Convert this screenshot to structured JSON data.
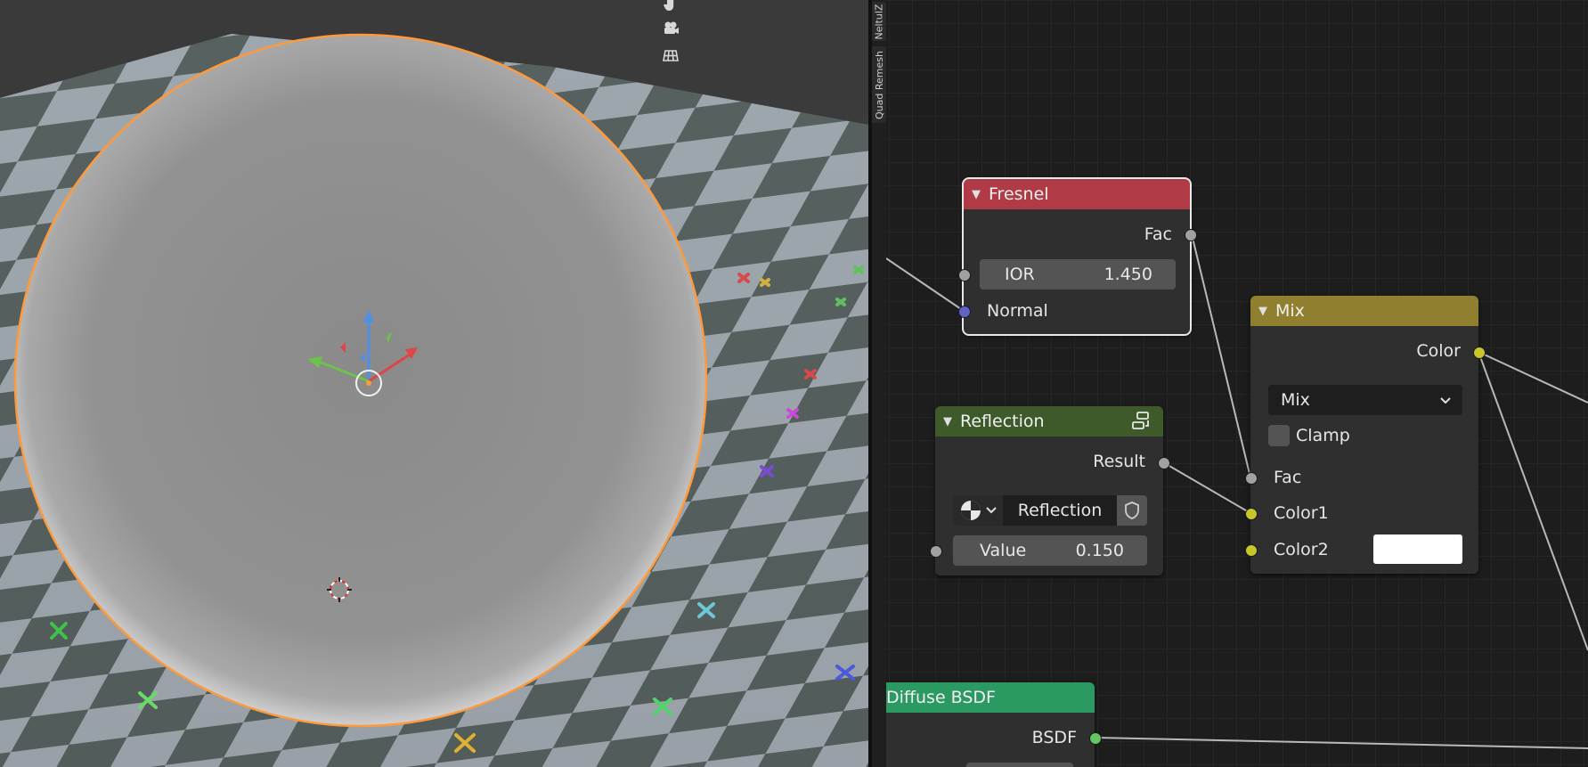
{
  "viewport": {
    "header_icons": [
      "hand-icon",
      "camera-icon",
      "grid-icon"
    ]
  },
  "sidebar_tabs": [
    "NeltulZ",
    "Quad Remesh"
  ],
  "nodes": {
    "fresnel": {
      "title": "Fresnel",
      "header_color": "#b03a45",
      "output_fac": "Fac",
      "ior_label": "IOR",
      "ior_value": "1.450",
      "normal_label": "Normal"
    },
    "mix": {
      "title": "Mix",
      "header_color": "#8f7f2e",
      "output_color": "Color",
      "blend_mode": "Mix",
      "clamp_label": "Clamp",
      "fac_label": "Fac",
      "color1_label": "Color1",
      "color2_label": "Color2",
      "color2_value": "#ffffff"
    },
    "reflection": {
      "title": "Reflection",
      "header_color": "#3f5a2a",
      "output_result": "Result",
      "texture_name": "Reflection",
      "value_label": "Value",
      "value": "0.150"
    },
    "diffuse": {
      "title": "Diffuse BSDF",
      "header_color": "#2a9a62",
      "output_bsdf": "BSDF"
    }
  },
  "colors": {
    "selection_outline": "#ff9a3c",
    "socket_float": "#a1a1a1",
    "socket_vector": "#6363c7",
    "socket_color": "#c7c729",
    "socket_shader": "#63c763"
  }
}
